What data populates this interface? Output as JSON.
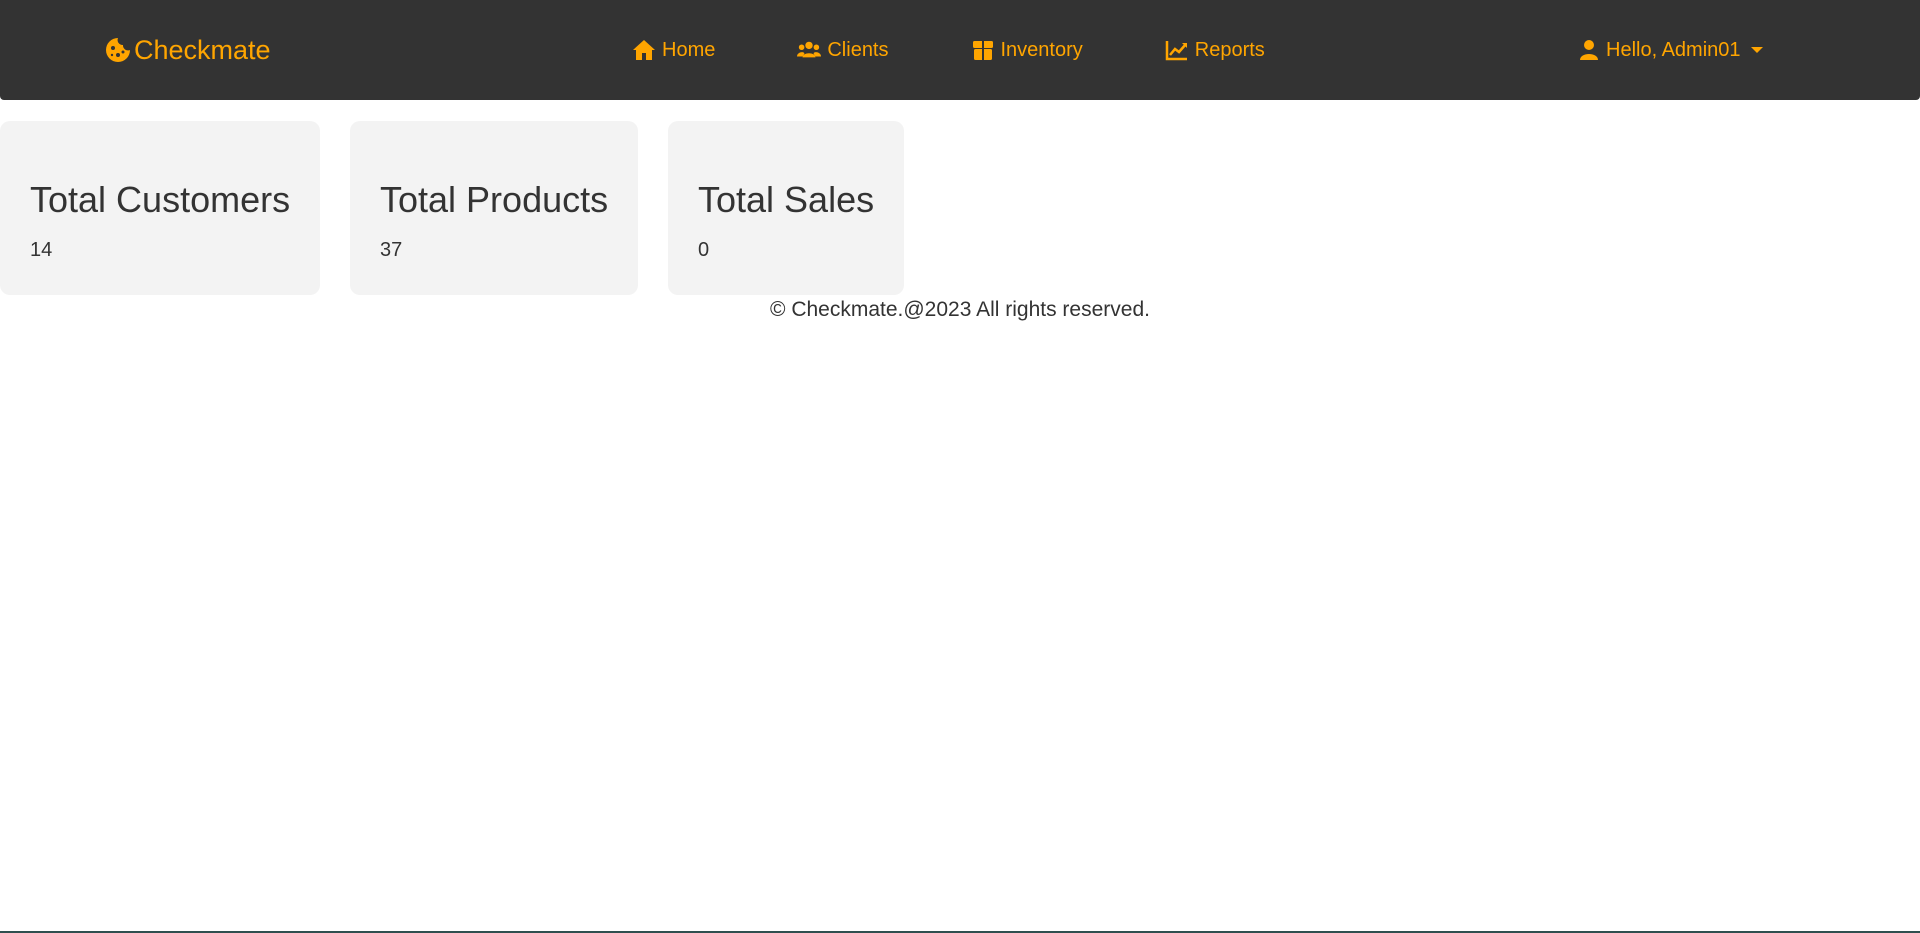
{
  "brand": {
    "name": "Checkmate",
    "icon": "cookie-icon"
  },
  "nav": {
    "items": [
      {
        "label": "Home",
        "icon": "home-icon"
      },
      {
        "label": "Clients",
        "icon": "users-icon"
      },
      {
        "label": "Inventory",
        "icon": "box-icon"
      },
      {
        "label": "Reports",
        "icon": "chart-line-icon"
      }
    ]
  },
  "user": {
    "greeting": "Hello, Admin01",
    "icon": "user-icon"
  },
  "stats": [
    {
      "title": "Total Customers",
      "value": "14"
    },
    {
      "title": "Total Products",
      "value": "37"
    },
    {
      "title": "Total Sales",
      "value": "0"
    }
  ],
  "footer": {
    "text": "© Checkmate.@2023 All rights reserved."
  },
  "colors": {
    "navbar": "#333333",
    "accent": "#ffa500",
    "card": "#f3f3f3"
  }
}
